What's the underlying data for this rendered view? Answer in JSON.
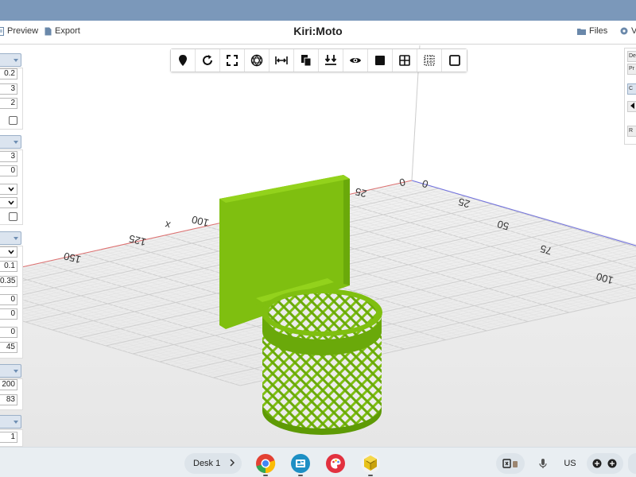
{
  "header": {
    "title": "Kiri:Moto",
    "preview_label": "Preview",
    "export_label": "Export",
    "files_label": "Files",
    "view_label": "V"
  },
  "left_panel": {
    "group1": [
      "0.2",
      "3",
      "2"
    ],
    "group2": [
      "3",
      "0"
    ],
    "group3": [
      "0.1",
      "0.35",
      "0",
      "0",
      "0",
      "45"
    ],
    "group4": [
      "200",
      "83"
    ],
    "group5": [
      "1"
    ]
  },
  "right_panel": {
    "tabs": [
      "De",
      "Pr",
      "C",
      "R"
    ]
  },
  "axes": {
    "x_ticks": [
      "0",
      "25",
      "x",
      "100",
      "125",
      "150"
    ],
    "y_ticks": [
      "0",
      "25",
      "50",
      "75",
      "100"
    ]
  },
  "shelf": {
    "desk_label": "Desk 1",
    "ime_label": "US"
  },
  "colors": {
    "model": "#7fbf10",
    "model_dark": "#5e9a05",
    "grid_major": "#cfcfcf",
    "grid_minor": "#e3e3e3",
    "axis_x": "#e07070",
    "axis_y": "#7070e0",
    "panel_accent": "#dbe4ef"
  }
}
